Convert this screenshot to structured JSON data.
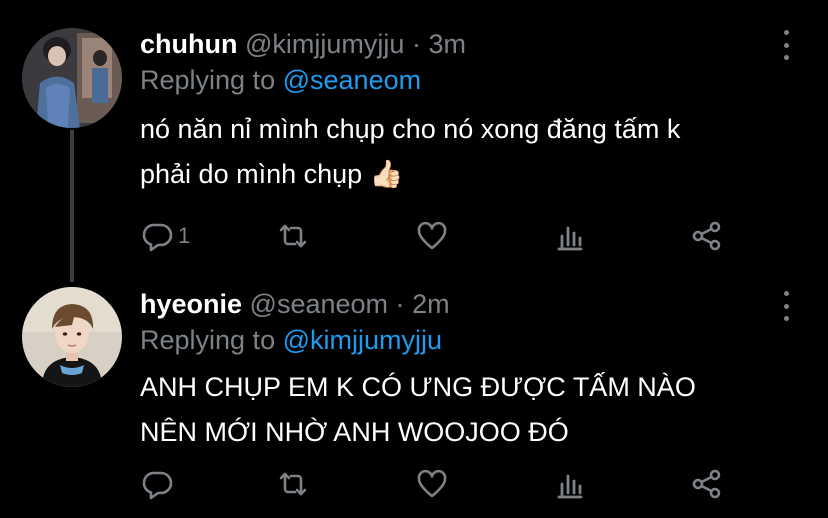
{
  "tweets": [
    {
      "display_name": "chuhun",
      "handle": "@kimjjumyjju",
      "separator": "·",
      "time": "3m",
      "replying_prefix": "Replying to",
      "replying_to": "@seaneom",
      "text_line1": "nó năn nỉ mình chụp cho nó xong đăng tấm k",
      "text_line2": "phải do mình chụp 👍🏻",
      "reply_count": "1"
    },
    {
      "display_name": "hyeonie",
      "handle": "@seaneom",
      "separator": "·",
      "time": "2m",
      "replying_prefix": "Replying to",
      "replying_to": "@kimjjumyjju",
      "text_line1": "ANH CHỤP EM K CÓ ƯNG ĐƯỢC TẤM NÀO",
      "text_line2": "NÊN MỚI NHỜ ANH WOOJOO ĐÓ",
      "reply_count": ""
    }
  ],
  "icons": {
    "reply": "comment-icon",
    "retweet": "retweet-icon",
    "like": "heart-icon",
    "views": "analytics-icon",
    "share": "share-icon",
    "more": "more-options-icon"
  },
  "colors": {
    "background": "#000000",
    "text": "#ffffff",
    "secondary": "#7d8287",
    "link": "#1d9bf0",
    "thread_line": "#3a3d41"
  }
}
